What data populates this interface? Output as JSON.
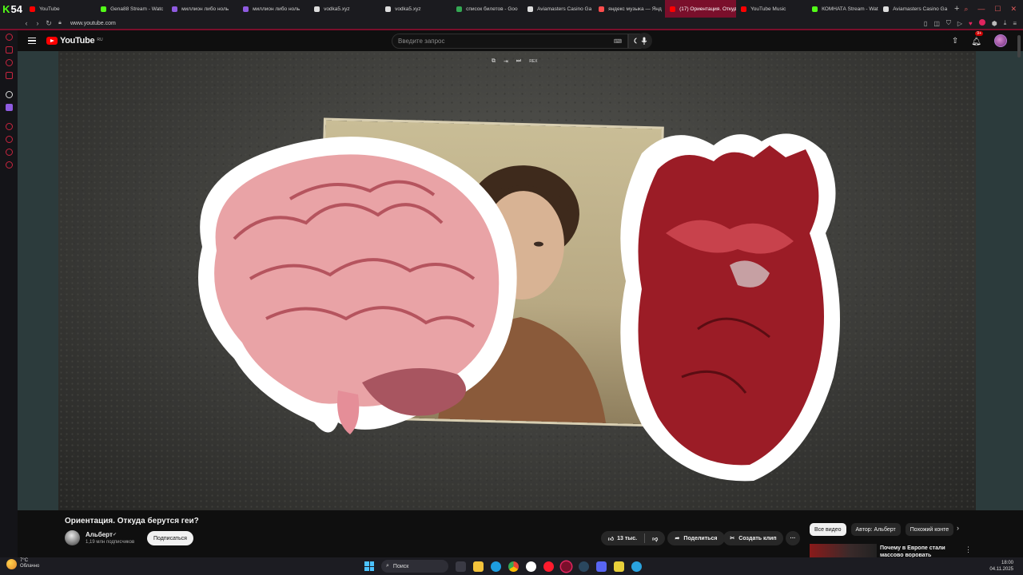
{
  "browser": {
    "tab_count_badge": "54",
    "tabs": [
      {
        "label": "YouTube",
        "color": "#ff0000",
        "active": false
      },
      {
        "label": "Gena88 Stream - Watc",
        "color": "#53fc18",
        "active": false
      },
      {
        "label": "миллион либо ноль",
        "color": "#8f5be0",
        "active": false
      },
      {
        "label": "миллион либо ноль",
        "color": "#8f5be0",
        "active": false
      },
      {
        "label": "vodka5.xyz",
        "color": "#dddddd",
        "active": false
      },
      {
        "label": "vodka5.xyz",
        "color": "#dddddd",
        "active": false
      },
      {
        "label": "список билетов - Goo",
        "color": "#34a853",
        "active": false
      },
      {
        "label": "Aviamasters Casino Ga",
        "color": "#dddddd",
        "active": false
      },
      {
        "label": "яндекс музыка — Янд",
        "color": "#ff4d4d",
        "active": false
      },
      {
        "label": "(17) Ориентация. Откуда",
        "color": "#ff0000",
        "active": true
      },
      {
        "label": "YouTube Music",
        "color": "#ff0000",
        "active": false
      },
      {
        "label": "КОМНАТА Stream - Watc",
        "color": "#53fc18",
        "active": false
      },
      {
        "label": "Aviamasters Casino Ga",
        "color": "#dddddd",
        "active": false
      }
    ],
    "new_tab": "+",
    "url": "www.youtube.com"
  },
  "youtube": {
    "logo_text": "YouTube",
    "logo_region": "RU",
    "search_placeholder": "Введите запрос",
    "keyboard_icon": "keyboard-icon",
    "notifications_badge": "9+"
  },
  "player": {
    "mini_buttons": [
      "miniplayer-icon",
      "exit-icon",
      "next-icon"
    ],
    "mini_label": "REX"
  },
  "video": {
    "title": "Ориентация. Откуда берутся геи?",
    "channel_name": "Альберт",
    "subscribers": "1,19 млн подписчиков",
    "subscribe_label": "Подписаться",
    "likes": "13 тыс.",
    "share_label": "Поделиться",
    "clip_label": "Создать клип",
    "more_label": "···"
  },
  "recommendations": {
    "chips": [
      {
        "label": "Все видео",
        "active": true
      },
      {
        "label": "Автор: Альберт",
        "active": false
      },
      {
        "label": "Похожий конте",
        "active": false
      }
    ],
    "items": [
      {
        "title": "Почему в Европе стали массово воровать смартфоны"
      }
    ]
  },
  "taskbar": {
    "weather_temp": "7°C",
    "weather_desc": "Облачно",
    "search_label": "Поиск",
    "time": "18:00",
    "date": "04.11.2025"
  },
  "colors": {
    "accent": "#ff0000",
    "browser_accent": "#7a0f2b",
    "background": "#0f0f0f"
  }
}
